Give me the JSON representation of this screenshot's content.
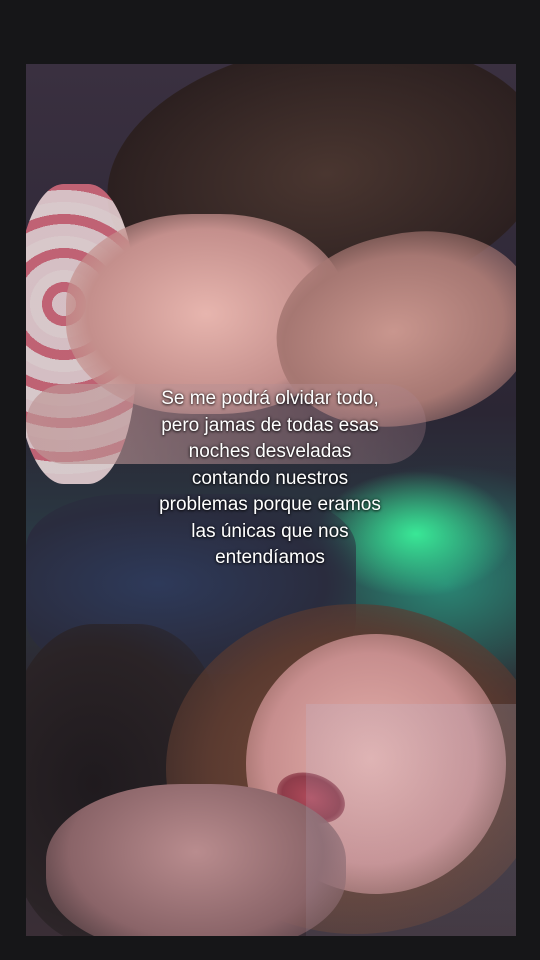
{
  "story": {
    "caption": "Se me podrá olvidar todo,\npero jamas de todas esas\nnoches desveladas\ncontando nuestros\nproblemas porque eramos\nlas únicas que nos\nentendíamos"
  },
  "colors": {
    "background": "#161618",
    "caption_text": "#ffffff",
    "accent_glow": "#3cffa0"
  }
}
